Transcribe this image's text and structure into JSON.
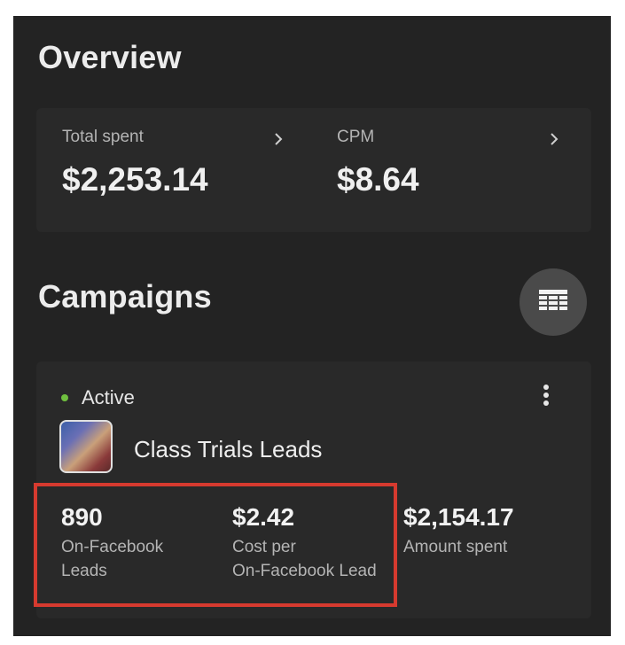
{
  "overview": {
    "title": "Overview",
    "metrics": [
      {
        "label": "Total spent",
        "value": "$2,253.14",
        "icon": "chevron-right-icon"
      },
      {
        "label": "CPM",
        "value": "$8.64",
        "icon": "chevron-right-icon"
      }
    ]
  },
  "campaigns": {
    "title": "Campaigns",
    "table_button_icon": "table-icon",
    "items": [
      {
        "status": "Active",
        "status_color": "#6fbf3f",
        "name": "Class Trials Leads",
        "thumbnail_icon": "campaign-thumbnail",
        "more_icon": "more-vertical-icon",
        "stats": [
          {
            "value": "890",
            "label_line1": "On-Facebook",
            "label_line2": "Leads"
          },
          {
            "value": "$2.42",
            "label_line1": "Cost per",
            "label_line2": "On-Facebook Lead"
          },
          {
            "value": "$2,154.17",
            "label_line1": "Amount spent",
            "label_line2": ""
          }
        ]
      }
    ]
  },
  "colors": {
    "background": "#232323",
    "card": "#292929",
    "highlight_border": "#d63a2f"
  }
}
